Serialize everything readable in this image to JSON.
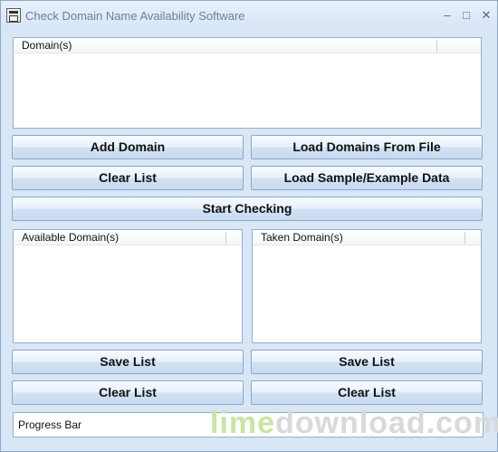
{
  "window": {
    "title": "Check Domain Name Availability Software",
    "controls": {
      "minimize": "–",
      "maximize": "□",
      "close": "✕"
    }
  },
  "domains": {
    "header": "Domain(s)",
    "items": []
  },
  "buttons": {
    "add_domain": "Add Domain",
    "load_domains_from_file": "Load Domains From File",
    "clear_list": "Clear List",
    "load_sample": "Load Sample/Example Data",
    "start_checking": "Start Checking"
  },
  "available": {
    "header": "Available Domain(s)",
    "items": [],
    "save_label": "Save List",
    "clear_label": "Clear List"
  },
  "taken": {
    "header": "Taken Domain(s)",
    "items": [],
    "save_label": "Save List",
    "clear_label": "Clear List"
  },
  "progress": {
    "label": "Progress Bar"
  },
  "watermark": {
    "part1": "lime",
    "part2": "download.com"
  },
  "icons": [
    "app-icon",
    "minimize-icon",
    "maximize-icon",
    "close-icon"
  ]
}
